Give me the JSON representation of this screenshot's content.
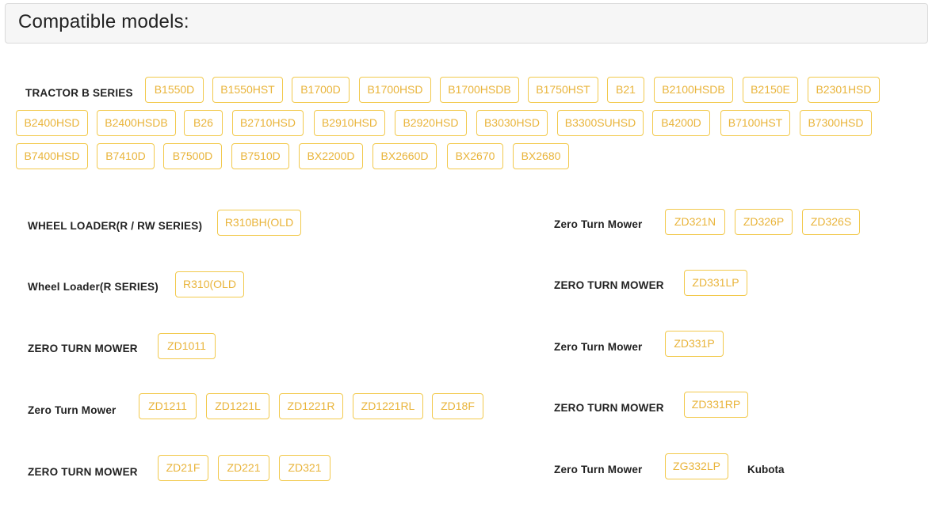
{
  "heading": "Compatible models:",
  "groups": [
    {
      "label": "TRACTOR B SERIES",
      "models": [
        "B1550D",
        "B1550HST",
        "B1700D",
        "B1700HSD",
        "B1700HSDB",
        "B1750HST",
        "B21",
        "B2100HSDB",
        "B2150E",
        "B2301HSD",
        "B2400HSD",
        "B2400HSDB",
        "B26",
        "B2710HSD",
        "B2910HSD",
        "B2920HSD",
        "B3030HSD",
        "B3300SUHSD",
        "B4200D",
        "B7100HST",
        "B7300HSD",
        "B7400HSD",
        "B7410D",
        "B7500D",
        "B7510D",
        "BX2200D",
        "BX2660D",
        "BX2670",
        "BX2680"
      ]
    },
    {
      "label": "WHEEL LOADER(R / RW SERIES)",
      "models": [
        "R310BH(OLD"
      ]
    },
    {
      "label": "Wheel Loader(R SERIES)",
      "models": [
        "R310(OLD"
      ]
    },
    {
      "label": "ZERO TURN MOWER",
      "models": [
        "ZD1011"
      ]
    },
    {
      "label": "Zero Turn Mower",
      "models": [
        "ZD1211",
        "ZD1221L",
        "ZD1221R",
        "ZD1221RL",
        "ZD18F"
      ]
    },
    {
      "label": "ZERO TURN MOWER",
      "models": [
        "ZD21F",
        "ZD221",
        "ZD321"
      ]
    },
    {
      "label": "Zero Turn Mower",
      "models": [
        "ZD321N",
        "ZD326P",
        "ZD326S"
      ]
    },
    {
      "label": "ZERO TURN MOWER",
      "models": [
        "ZD331LP"
      ]
    },
    {
      "label": "Zero Turn Mower",
      "models": [
        "ZD331P"
      ]
    },
    {
      "label": "ZERO TURN MOWER",
      "models": [
        "ZD331RP"
      ]
    },
    {
      "label": "Zero Turn Mower",
      "models": [
        "ZG332LP"
      ],
      "trailing_text": "Kubota"
    }
  ],
  "colors": {
    "chip_border": "#f2c94c",
    "chip_text": "#e9b43a",
    "header_bg": "#f6f6f6"
  }
}
